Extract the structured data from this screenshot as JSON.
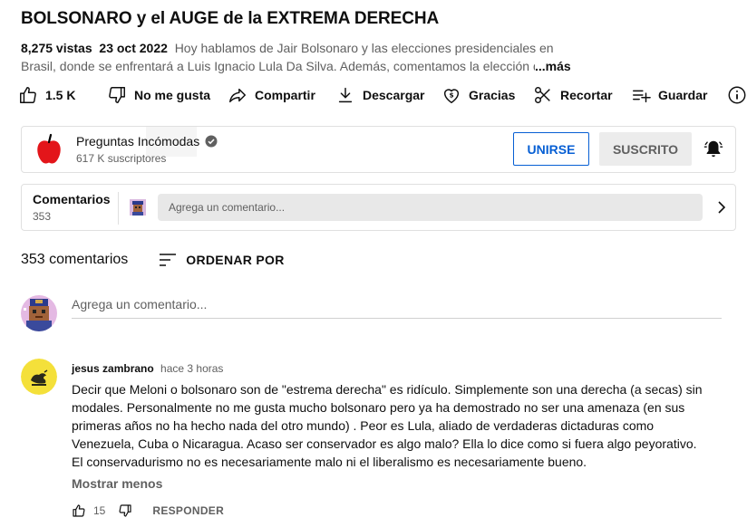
{
  "video": {
    "title": "BOLSONARO y el AUGE de la EXTREMA DERECHA",
    "views": "8,275 vistas",
    "date": "23 oct 2022",
    "desc_line1": "Hoy hablamos de Jair Bolsonaro y las elecciones presidenciales en",
    "desc_line2": "Brasil, donde se enfrentará a Luis Ignacio Lula Da Silva. Además, comentamos la elección d",
    "more_label": "...más"
  },
  "actions": {
    "like_count": "1.5 K",
    "dislike_label": "No me gusta",
    "share_label": "Compartir",
    "download_label": "Descargar",
    "thanks_label": "Gracias",
    "clip_label": "Recortar",
    "save_label": "Guardar"
  },
  "channel": {
    "name": "Preguntas Incómodas",
    "subscribers": "617 K suscriptores",
    "join_label": "UNIRSE",
    "subscribed_label": "SUSCRITO"
  },
  "comments_panel": {
    "title": "Comentarios",
    "count": "353",
    "placeholder": "Agrega un comentario..."
  },
  "comments_section": {
    "count_label": "353 comentarios",
    "sort_label": "ORDENAR POR",
    "add_placeholder": "Agrega un comentario..."
  },
  "comment": {
    "author": "jesus zambrano",
    "time": "hace 3 horas",
    "lines": [
      "Decir que Meloni o bolsonaro son de \"estrema derecha\" es ridículo. Simplemente son una derecha (a secas) sin",
      "modales. Personalmente no me gusta mucho bolsonaro pero ya ha demostrado no ser una amenaza (en sus",
      "primeras años no ha hecho nada del otro mundo) . Peor es Lula, aliado de verdaderas dictaduras como",
      "Venezuela, Cuba o Nicaragua. Acaso ser conservador es algo malo? Ella lo dice como si fuera algo peyorativo.",
      "El conservadurismo no es necesariamente malo ni el liberalismo es necesariamente bueno."
    ],
    "show_less_label": "Mostrar menos",
    "likes": "15",
    "reply_label": "RESPONDER"
  },
  "colors": {
    "accent_blue": "#065fd4",
    "text_secondary": "#606060",
    "apple_red": "#e3151a"
  }
}
